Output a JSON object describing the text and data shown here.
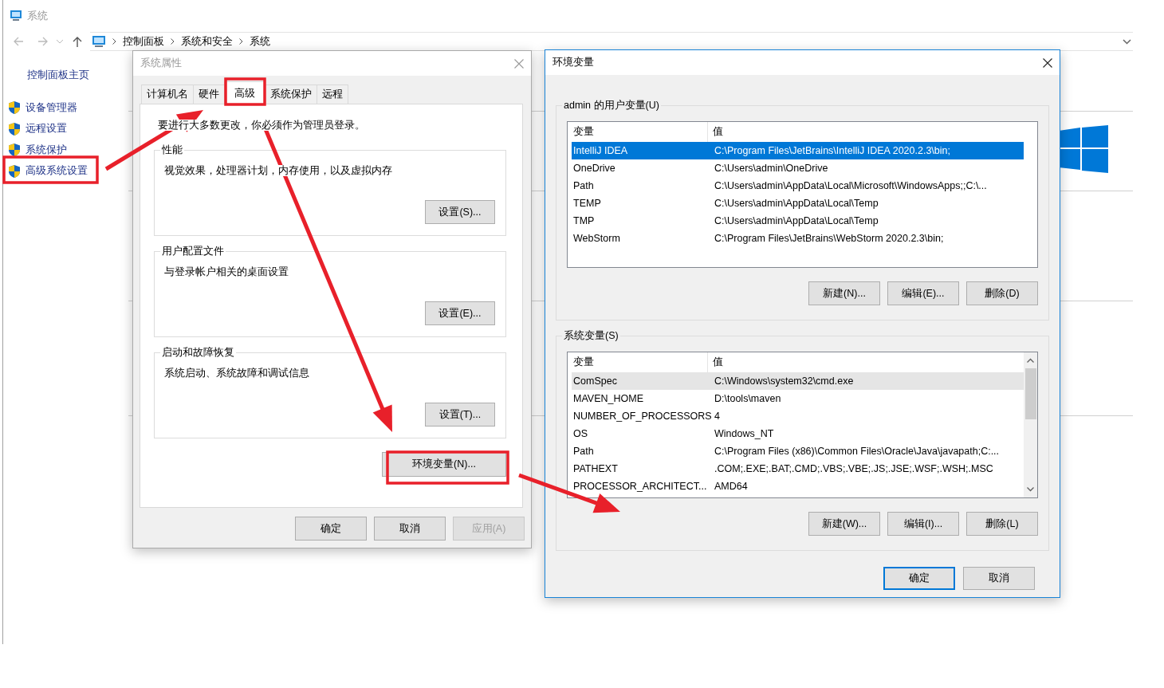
{
  "explorer": {
    "title": "系统",
    "breadcrumb": [
      "控制面板",
      "系统和安全",
      "系统"
    ],
    "sidebar": {
      "home": "控制面板主页",
      "items": [
        {
          "label": "设备管理器"
        },
        {
          "label": "远程设置"
        },
        {
          "label": "系统保护"
        },
        {
          "label": "高级系统设置"
        }
      ]
    }
  },
  "system_properties": {
    "title": "系统属性",
    "active": false,
    "tabs": [
      {
        "label": "计算机名",
        "selected": false
      },
      {
        "label": "硬件",
        "selected": false
      },
      {
        "label": "高级",
        "selected": true
      },
      {
        "label": "系统保护",
        "selected": false
      },
      {
        "label": "远程",
        "selected": false
      }
    ],
    "notice": "要进行大多数更改，你必须作为管理员登录。",
    "groups": [
      {
        "title": "性能",
        "description": "视觉效果，处理器计划，内存使用，以及虚拟内存",
        "button": "设置(S)..."
      },
      {
        "title": "用户配置文件",
        "description": "与登录帐户相关的桌面设置",
        "button": "设置(E)..."
      },
      {
        "title": "启动和故障恢复",
        "description": "系统启动、系统故障和调试信息",
        "button": "设置(T)..."
      }
    ],
    "env_button": "环境变量(N)...",
    "buttons": [
      {
        "label": "确定",
        "disabled": false
      },
      {
        "label": "取消",
        "disabled": false
      },
      {
        "label": "应用(A)",
        "disabled": true
      }
    ]
  },
  "environment_variables": {
    "title": "环境变量",
    "active": true,
    "user_variables": {
      "title": "admin 的用户变量(U)",
      "focused": true,
      "columns": [
        "变量",
        "值"
      ],
      "rows": [
        {
          "name": "IntelliJ IDEA",
          "value": "C:\\Program Files\\JetBrains\\IntelliJ IDEA 2020.2.3\\bin;",
          "selected": true
        },
        {
          "name": "OneDrive",
          "value": "C:\\Users\\admin\\OneDrive",
          "selected": false
        },
        {
          "name": "Path",
          "value": "C:\\Users\\admin\\AppData\\Local\\Microsoft\\WindowsApps;;C:\\...",
          "selected": false
        },
        {
          "name": "TEMP",
          "value": "C:\\Users\\admin\\AppData\\Local\\Temp",
          "selected": false
        },
        {
          "name": "TMP",
          "value": "C:\\Users\\admin\\AppData\\Local\\Temp",
          "selected": false
        },
        {
          "name": "WebStorm",
          "value": "C:\\Program Files\\JetBrains\\WebStorm 2020.2.3\\bin;",
          "selected": false
        }
      ],
      "buttons": [
        "新建(N)...",
        "编辑(E)...",
        "删除(D)"
      ]
    },
    "system_variables": {
      "title": "系统变量(S)",
      "focused": false,
      "columns": [
        "变量",
        "值"
      ],
      "rows": [
        {
          "name": "ComSpec",
          "value": "C:\\Windows\\system32\\cmd.exe",
          "selected": true
        },
        {
          "name": "MAVEN_HOME",
          "value": "D:\\tools\\maven",
          "selected": false
        },
        {
          "name": "NUMBER_OF_PROCESSORS",
          "value": "4",
          "selected": false
        },
        {
          "name": "OS",
          "value": "Windows_NT",
          "selected": false
        },
        {
          "name": "Path",
          "value": "C:\\Program Files (x86)\\Common Files\\Oracle\\Java\\javapath;C:...",
          "selected": false
        },
        {
          "name": "PATHEXT",
          "value": ".COM;.EXE;.BAT;.CMD;.VBS;.VBE;.JS;.JSE;.WSF;.WSH;.MSC",
          "selected": false
        },
        {
          "name": "PROCESSOR_ARCHITECT...",
          "value": "AMD64",
          "selected": false
        }
      ],
      "buttons": [
        "新建(W)...",
        "编辑(I)...",
        "删除(L)"
      ]
    },
    "buttons": [
      {
        "label": "确定",
        "default": true
      },
      {
        "label": "取消",
        "default": false
      }
    ]
  }
}
